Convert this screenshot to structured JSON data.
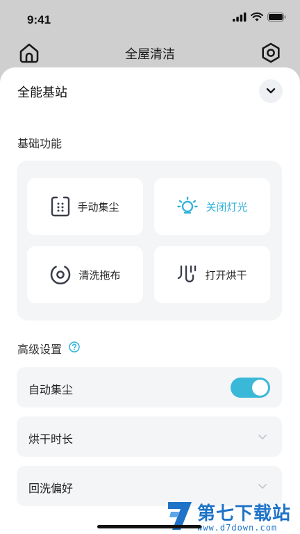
{
  "status": {
    "time": "9:41"
  },
  "header": {
    "title": "全屋清洁"
  },
  "sheet": {
    "title": "全能基站"
  },
  "basic": {
    "label": "基础功能",
    "items": [
      {
        "label": "手动集尘",
        "icon": "dust-bin-icon",
        "active": false
      },
      {
        "label": "关闭灯光",
        "icon": "lightbulb-icon",
        "active": true
      },
      {
        "label": "清洗拖布",
        "icon": "mop-wash-icon",
        "active": false
      },
      {
        "label": "打开烘干",
        "icon": "dry-heat-icon",
        "active": false
      }
    ]
  },
  "advanced": {
    "label": "高级设置",
    "rows": [
      {
        "label": "自动集尘",
        "control": "toggle",
        "value": true
      },
      {
        "label": "烘干时长",
        "control": "dropdown"
      },
      {
        "label": "回洗偏好",
        "control": "dropdown"
      }
    ]
  },
  "watermark": {
    "title": "第七下载站",
    "url": "www.d7down.com"
  },
  "colors": {
    "accent": "#3ab8d8",
    "active_text": "#2fb3d9",
    "panel": "#f4f5f7",
    "watermark": "#1e73c8"
  }
}
